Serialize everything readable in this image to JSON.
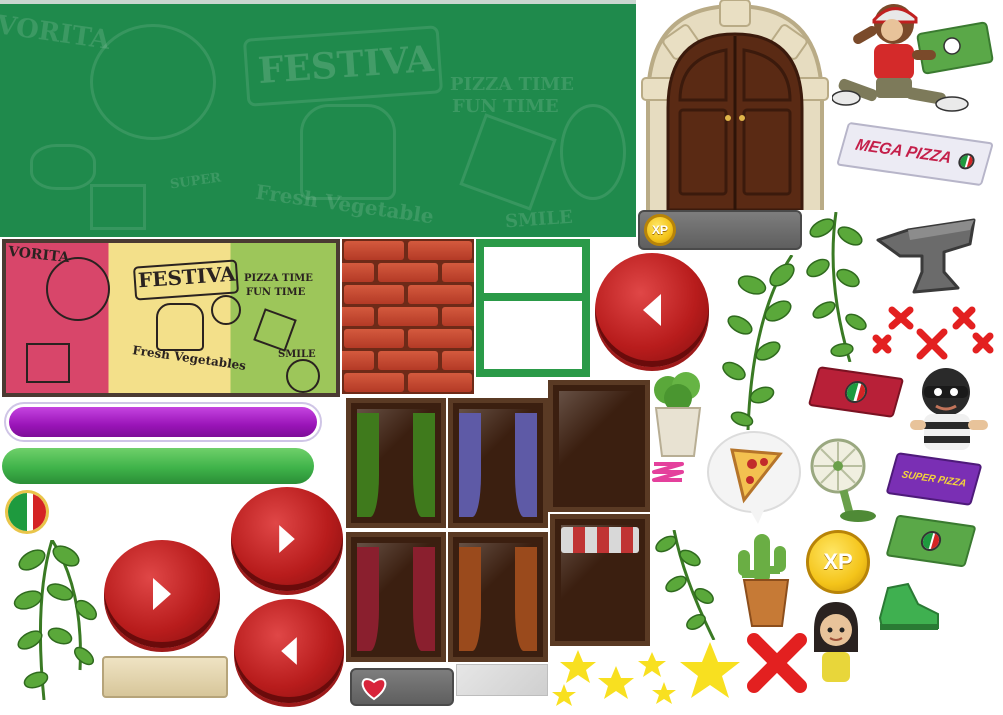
{
  "banner": {
    "words": {
      "favorita": "VORITA",
      "festiva": "FESTIVA",
      "pizza_time": "PIZZA TIME",
      "fun_time": "FUN TIME",
      "fresh_vegetable": "Fresh Vegetable",
      "super": "SUPER",
      "smile": "SMILE"
    }
  },
  "tricolor_banner": {
    "words": {
      "favorita": "VORITA",
      "festiva": "FESTIVA",
      "pizza_time": "PIZZA TIME",
      "fun_time": "FUN TIME",
      "fresh_vegetables": "Fresh Vegetables",
      "smile": "SMILE"
    },
    "colors": {
      "left": "#d8466a",
      "middle": "#f3e08a",
      "right": "#9dc65a"
    }
  },
  "progress_bars": {
    "purple": {
      "color": "#a51fc6"
    },
    "green": {
      "color": "#3fb34a"
    }
  },
  "buttons": {
    "play_large": {
      "icon": "play-icon"
    },
    "play_small": {
      "icon": "play-icon"
    },
    "back_small": {
      "icon": "back-icon"
    },
    "back_top": {
      "icon": "back-icon"
    }
  },
  "xp": {
    "label": "XP"
  },
  "pizza_boxes": {
    "mega": "MEGA PIZZA",
    "super": "SUPER PIZZA"
  },
  "curtain_colors": [
    "#3f7a1c",
    "#5e5aa6",
    "#8a1f2e",
    "#9a4a1c"
  ],
  "colors": {
    "banner_green": "#1f8a4c",
    "button_red": "#b81c1c",
    "gold": "#f4c41a",
    "brick": "#c24a30"
  }
}
